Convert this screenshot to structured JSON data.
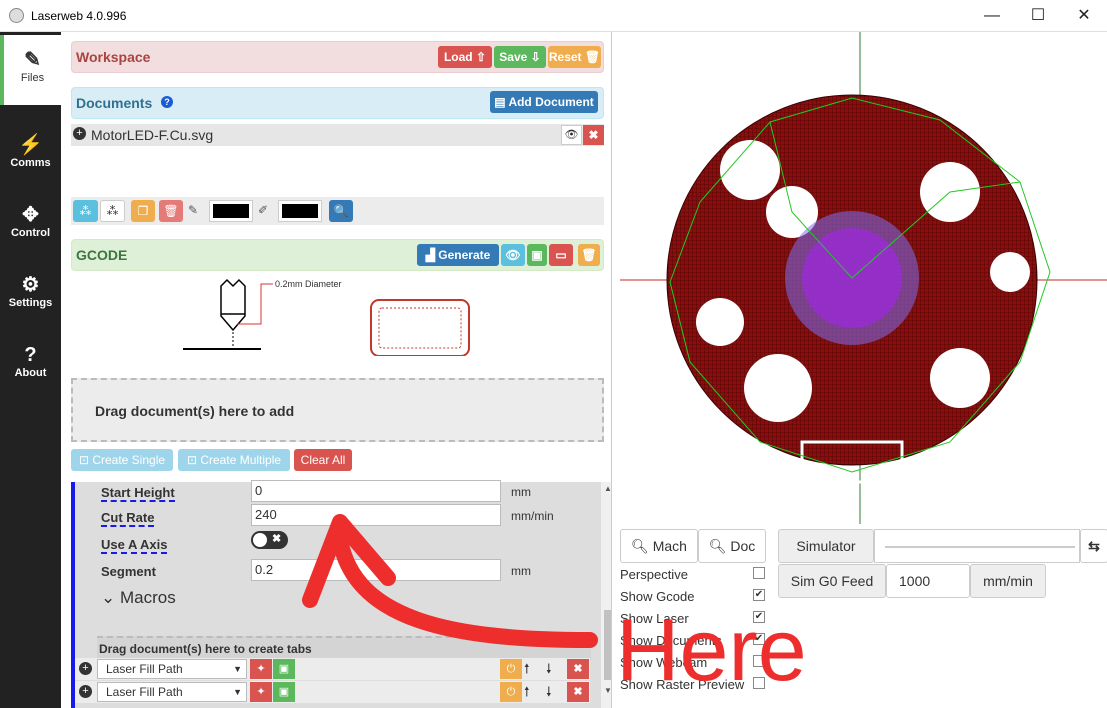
{
  "window": {
    "title": "Laserweb 4.0.996",
    "minimize": "—",
    "maximize": "☐",
    "close": "✕"
  },
  "sidebar": {
    "items": [
      {
        "label": "Files",
        "icon": "✎"
      },
      {
        "label": "Comms",
        "icon": "⚡"
      },
      {
        "label": "Control",
        "icon": "✥"
      },
      {
        "label": "Settings",
        "icon": "⚙"
      },
      {
        "label": "About",
        "icon": "?"
      }
    ]
  },
  "workspace": {
    "title": "Workspace",
    "load": "Load ⇧",
    "save": "Save ⇩",
    "reset": "Reset 🗑"
  },
  "documents": {
    "title": "Documents",
    "help_icon": "?",
    "add": "Add Document",
    "file": "MotorLED-F.Cu.svg"
  },
  "gcode": {
    "title": "GCODE",
    "generate": "Generate",
    "diameter_label": "0.2mm Diameter"
  },
  "drop": {
    "add": "Drag document(s) here to add",
    "tabs": "Drag document(s) here to create tabs"
  },
  "ops": {
    "create_single": "Create Single",
    "create_multiple": "Create Multiple",
    "clear_all": "Clear All"
  },
  "form": {
    "start_height": {
      "label": "Start Height",
      "value": "0",
      "unit": "mm"
    },
    "cut_rate": {
      "label": "Cut Rate",
      "value": "240",
      "unit": "mm/min"
    },
    "use_a_axis": {
      "label": "Use A Axis"
    },
    "segment": {
      "label": "Segment",
      "value": "0.2",
      "unit": "mm"
    },
    "macros": "Macros"
  },
  "operations": [
    {
      "type": "Laser Fill Path"
    },
    {
      "type": "Laser Fill Path"
    }
  ],
  "viewer": {
    "mach": "Mach",
    "doc": "Doc",
    "simulator": "Simulator",
    "sim_feed_label": "Sim G0 Feed",
    "sim_feed_value": "1000",
    "sim_feed_unit": "mm/min",
    "options": [
      {
        "label": "Perspective",
        "checked": false
      },
      {
        "label": "Show Gcode",
        "checked": true
      },
      {
        "label": "Show Laser",
        "checked": true
      },
      {
        "label": "Show Documents",
        "checked": true
      },
      {
        "label": "Show Webcam",
        "checked": false
      },
      {
        "label": "Show Raster Preview",
        "checked": false
      }
    ]
  },
  "annotation": {
    "text": "Here",
    "color": "#ee2d2d"
  },
  "colors": {
    "accent_red": "#d9534f",
    "accent_green": "#5cb85c",
    "accent_blue": "#337ab7",
    "pcb": "#8b0d0d"
  }
}
